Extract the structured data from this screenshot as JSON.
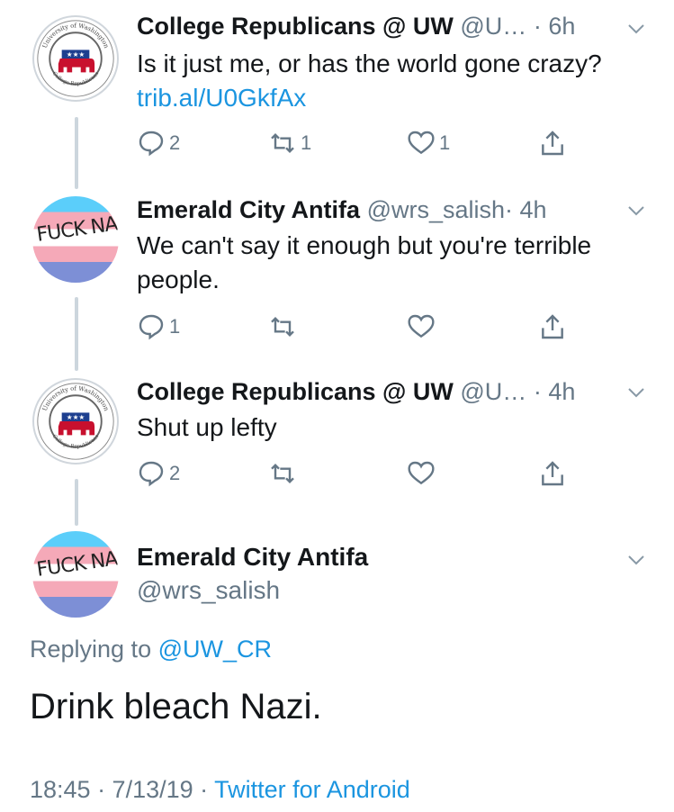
{
  "tweets": [
    {
      "name": "College Republicans @ UW",
      "handle": "@U…",
      "time": "· 6h",
      "text": "Is it just me, or has the world gone crazy? ",
      "link": "trib.al/U0GkfAx",
      "replies": "2",
      "retweets": "1",
      "likes": "1",
      "avatar": {
        "ring_text": "University of Washington",
        "ring_text_bottom": "College Republicans"
      }
    },
    {
      "name": "Emerald City Antifa",
      "handle": "@wrs_salish",
      "time": "· 4h",
      "text": "We can't say it enough but you're terrible people.",
      "replies": "1",
      "retweets": "",
      "likes": "",
      "avatar": {
        "graffiti": "FUCK NAZIS"
      }
    },
    {
      "name": "College Republicans @ UW",
      "handle": "@U…",
      "time": "· 4h",
      "text": "Shut up lefty",
      "replies": "2",
      "retweets": "",
      "likes": "",
      "avatar": {
        "ring_text": "University of Washington",
        "ring_text_bottom": "College Republicans"
      }
    }
  ],
  "detail": {
    "name": "Emerald City Antifa",
    "handle": "@wrs_salish",
    "replying_prefix": "Replying to ",
    "replying_handle": "@UW_CR",
    "text": "Drink bleach Nazi.",
    "timestamp": "18:45 · 7/13/19 · ",
    "client": "Twitter for Android",
    "avatar": {
      "graffiti": "FUCK NAZIS"
    }
  },
  "colors": {
    "link": "#1b95e0",
    "secondary": "#657786",
    "thread": "#ccd6dd"
  }
}
